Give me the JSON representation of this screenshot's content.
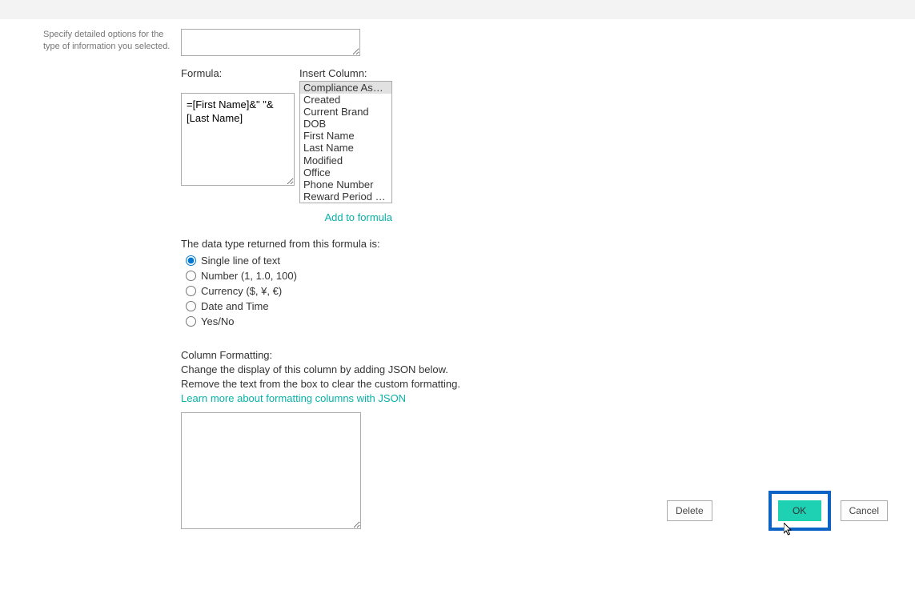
{
  "leftDescription": "Specify detailed options for the type of information you selected.",
  "descriptionValue": "",
  "formula": {
    "label": "Formula:",
    "value": "=[First Name]&\" \"&[Last Name]"
  },
  "insertColumn": {
    "label": "Insert Column:",
    "items": [
      {
        "label": "Compliance Asset Id",
        "selected": true
      },
      {
        "label": "Created",
        "selected": false
      },
      {
        "label": "Current Brand",
        "selected": false
      },
      {
        "label": "DOB",
        "selected": false
      },
      {
        "label": "First Name",
        "selected": false
      },
      {
        "label": "Last Name",
        "selected": false
      },
      {
        "label": "Modified",
        "selected": false
      },
      {
        "label": "Office",
        "selected": false
      },
      {
        "label": "Phone Number",
        "selected": false
      },
      {
        "label": "Reward Period End",
        "selected": false
      }
    ],
    "addLink": "Add to formula"
  },
  "dataType": {
    "heading": "The data type returned from this formula is:",
    "options": [
      {
        "id": "single-line",
        "label": "Single line of text",
        "checked": true
      },
      {
        "id": "number",
        "label": "Number (1, 1.0, 100)",
        "checked": false
      },
      {
        "id": "currency",
        "label": "Currency ($, ¥, €)",
        "checked": false
      },
      {
        "id": "datetime",
        "label": "Date and Time",
        "checked": false
      },
      {
        "id": "yesno",
        "label": "Yes/No",
        "checked": false
      }
    ]
  },
  "formatting": {
    "heading": "Column Formatting:",
    "line1": "Change the display of this column by adding JSON below.",
    "line2": "Remove the text from the box to clear the custom formatting.",
    "link": "Learn more about formatting columns with JSON",
    "value": ""
  },
  "buttons": {
    "delete": "Delete",
    "ok": "OK",
    "cancel": "Cancel"
  }
}
